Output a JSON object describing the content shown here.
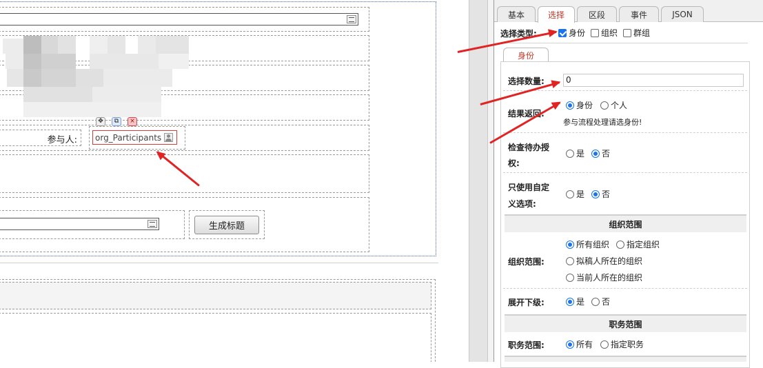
{
  "form": {
    "participant_label": "参与人:",
    "participant_field": "org_Participants",
    "generate_title_button": "生成标题"
  },
  "panel": {
    "tabs": [
      {
        "label": "基本"
      },
      {
        "label": "选择"
      },
      {
        "label": "区段"
      },
      {
        "label": "事件"
      },
      {
        "label": "JSON"
      }
    ],
    "select_type": {
      "label": "选择类型:",
      "options": [
        {
          "label": "身份",
          "checked": true
        },
        {
          "label": "组织",
          "checked": false
        },
        {
          "label": "群组",
          "checked": false
        }
      ]
    },
    "subtab": "身份",
    "select_count": {
      "label": "选择数量:",
      "value": "0"
    },
    "result_return": {
      "label": "结果返回:",
      "options": [
        {
          "label": "身份",
          "selected": true
        },
        {
          "label": "个人",
          "selected": false
        }
      ],
      "hint": "参与流程处理请选身份!"
    },
    "check_auth": {
      "label_line1": "检查待办授",
      "label_line2": "权:",
      "options": [
        {
          "label": "是",
          "selected": false
        },
        {
          "label": "否",
          "selected": true
        }
      ]
    },
    "custom_only": {
      "label_line1": "只使用自定",
      "label_line2": "义选项:",
      "options": [
        {
          "label": "是",
          "selected": false
        },
        {
          "label": "否",
          "selected": true
        }
      ]
    },
    "org_section": {
      "title": "组织范围",
      "row_label": "组织范围:",
      "options": [
        {
          "label": "所有组织",
          "selected": true
        },
        {
          "label": "指定组织",
          "selected": false
        },
        {
          "label": "拟稿人所在的组织",
          "selected": false
        },
        {
          "label": "当前人所在的组织",
          "selected": false
        }
      ]
    },
    "expand_sub": {
      "label": "展开下级:",
      "options": [
        {
          "label": "是",
          "selected": true
        },
        {
          "label": "否",
          "selected": false
        }
      ]
    },
    "duty_section": {
      "title": "职务范围",
      "row_label": "职务范围:",
      "options": [
        {
          "label": "所有",
          "selected": true
        },
        {
          "label": "指定职务",
          "selected": false
        }
      ]
    }
  },
  "colors": {
    "accent": "#1a73e8",
    "arrow": "#e02424",
    "active_tab_text": "#c0392b",
    "field_border": "#d83a3a"
  }
}
